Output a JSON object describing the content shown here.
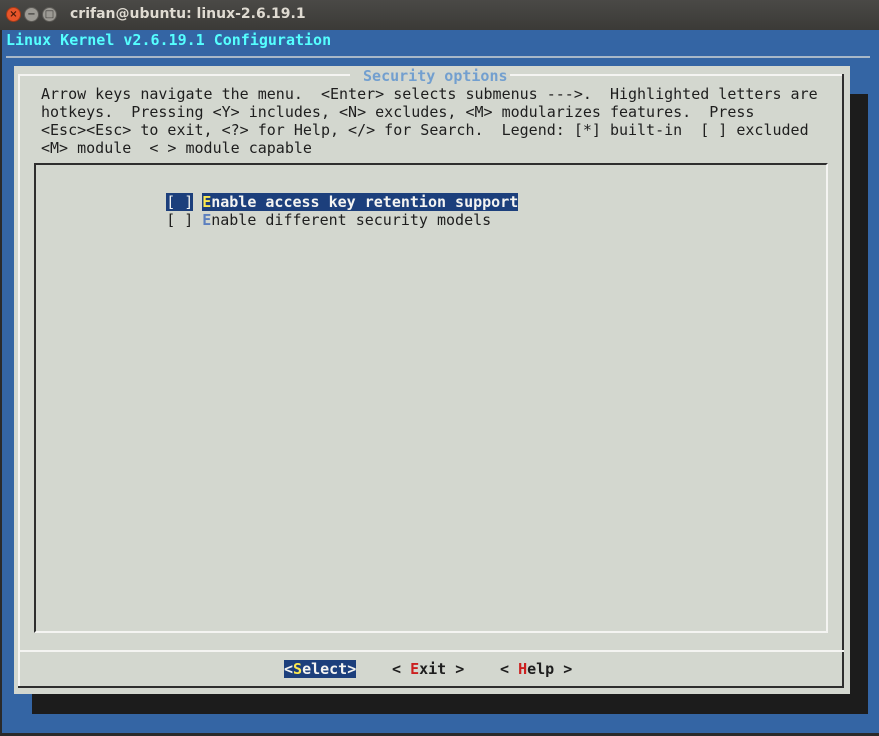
{
  "window": {
    "title": "crifan@ubuntu: linux-2.6.19.1",
    "close_glyph": "×",
    "min_glyph": "−",
    "max_glyph": "□"
  },
  "terminal": {
    "banner": "Linux Kernel v2.6.19.1 Configuration"
  },
  "dialog": {
    "title": " Security options ",
    "help_text": "Arrow keys navigate the menu.  <Enter> selects submenus --->.  Highlighted letters are\nhotkeys.  Pressing <Y> includes, <N> excludes, <M> modularizes features.  Press\n<Esc><Esc> to exit, <?> for Help, </> for Search.  Legend: [*] built-in  [ ] excluded\n<M> module  < > module capable",
    "items": [
      {
        "mark": "[ ]",
        "hotkey": "E",
        "rest": "nable access key retention support",
        "selected": true
      },
      {
        "mark": "[ ]",
        "hotkey": "E",
        "rest": "nable different security models",
        "selected": false
      }
    ],
    "buttons": {
      "select": {
        "open": "<",
        "hotkey": "S",
        "rest": "elect>"
      },
      "exit": {
        "open": "< ",
        "hotkey": "E",
        "rest": "xit >"
      },
      "help": {
        "open": "< ",
        "hotkey": "H",
        "rest": "elp >"
      }
    }
  },
  "colors": {
    "terminal_bg": "#3465a4",
    "dialog_bg": "#d3d7cf",
    "highlight": "#1c3f7c",
    "hotkey_selected": "#fce94f",
    "hotkey_button": "#cc1f1f",
    "banner_text": "#55ffff",
    "dialog_title": "#729fcf"
  }
}
